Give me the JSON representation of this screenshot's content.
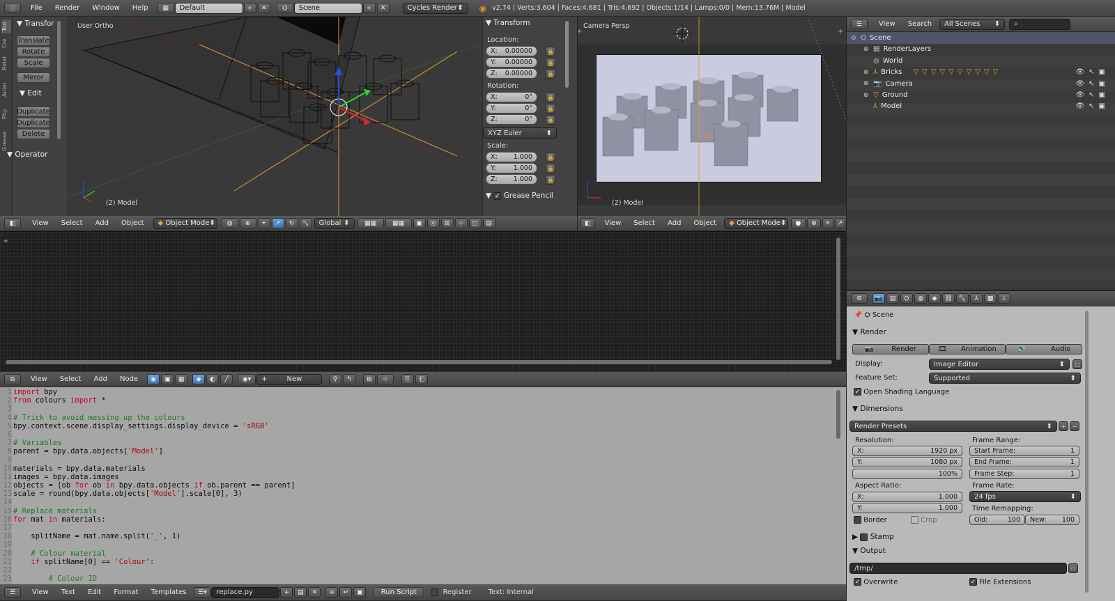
{
  "topbar": {
    "menus": [
      "File",
      "Render",
      "Window",
      "Help"
    ],
    "screen_layout": "Default",
    "scene": "Scene",
    "render_engine": "Cycles Render",
    "stats": "v2.74 | Verts:3,604 | Faces:4,681 | Tris:4,692 | Objects:1/14 | Lamps:0/0 | Mem:13.76M | Model"
  },
  "toolshelf": {
    "tabs": [
      "Too",
      "Cre",
      "Relat",
      "Anim",
      "Phy",
      "Grease"
    ],
    "transform_title": "Transfor",
    "transform_buttons": [
      "Translate",
      "Rotate",
      "Scale"
    ],
    "mirror": "Mirror",
    "edit_title": "Edit",
    "edit_buttons": [
      "Duplicate",
      "Duplicate",
      "Delete"
    ],
    "operator_title": "Operator"
  },
  "viewport_left": {
    "view_name": "User Ortho",
    "object_label": "(2) Model",
    "header": {
      "menus": [
        "View",
        "Select",
        "Add",
        "Object"
      ],
      "mode": "Object Mode",
      "orientation": "Global"
    }
  },
  "transform_panel": {
    "title": "Transform",
    "location_label": "Location:",
    "location": [
      {
        "axis": "X:",
        "value": "0.00000"
      },
      {
        "axis": "Y:",
        "value": "0.00000"
      },
      {
        "axis": "Z:",
        "value": "0.00000"
      }
    ],
    "rotation_label": "Rotation:",
    "rotation": [
      {
        "axis": "X:",
        "value": "0°"
      },
      {
        "axis": "Y:",
        "value": "0°"
      },
      {
        "axis": "Z:",
        "value": "0°"
      }
    ],
    "rotation_mode": "XYZ Euler",
    "scale_label": "Scale:",
    "scale": [
      {
        "axis": "X:",
        "value": "1.000"
      },
      {
        "axis": "Y:",
        "value": "1.000"
      },
      {
        "axis": "Z:",
        "value": "1.000"
      }
    ],
    "grease_pencil": "Grease Pencil"
  },
  "viewport_right": {
    "view_name": "Camera Persp",
    "object_label": "(2) Model",
    "header": {
      "menus": [
        "View",
        "Select",
        "Add",
        "Object"
      ],
      "mode": "Object Mode"
    }
  },
  "node_editor": {
    "header": {
      "menus": [
        "View",
        "Select",
        "Add",
        "Node"
      ],
      "new_button": "New"
    }
  },
  "text_editor": {
    "lines": [
      {
        "n": "1",
        "html": "<span class=\"kw\">import</span> bpy"
      },
      {
        "n": "2",
        "html": "<span class=\"kw\">from</span> colours <span class=\"kw\">import</span> *"
      },
      {
        "n": "3",
        "html": ""
      },
      {
        "n": "4",
        "html": "<span class=\"cm\"># Trick to avoid messing up the colours</span>"
      },
      {
        "n": "5",
        "html": "bpy.context.scene.display_settings.display_device = <span class=\"st\">'sRGB'</span>"
      },
      {
        "n": "6",
        "html": ""
      },
      {
        "n": "7",
        "html": "<span class=\"cm\"># Variables</span>"
      },
      {
        "n": "8",
        "html": "parent = bpy.data.objects[<span class=\"st\">'Model'</span>]"
      },
      {
        "n": "9",
        "html": ""
      },
      {
        "n": "10",
        "html": "materials = bpy.data.materials"
      },
      {
        "n": "11",
        "html": "images = bpy.data.images"
      },
      {
        "n": "12",
        "html": "objects = [ob <span class=\"kw\">for</span> ob <span class=\"kw\">in</span> bpy.data.objects <span class=\"kw\">if</span> ob.parent == parent]"
      },
      {
        "n": "13",
        "html": "scale = round(bpy.data.objects[<span class=\"st\">'Model'</span>].scale[0], 3)"
      },
      {
        "n": "14",
        "html": ""
      },
      {
        "n": "15",
        "html": "<span class=\"cm\"># Replace materials</span>"
      },
      {
        "n": "16",
        "html": "<span class=\"kw\">for</span> mat <span class=\"kw\">in</span> materials:"
      },
      {
        "n": "17",
        "html": ""
      },
      {
        "n": "18",
        "html": "    splitName = mat.name.split(<span class=\"st\">'_'</span>, 1)"
      },
      {
        "n": "19",
        "html": ""
      },
      {
        "n": "20",
        "html": "    <span class=\"cm\"># Colour material</span>"
      },
      {
        "n": "21",
        "html": "    <span class=\"kw\">if</span> splitName[0] == <span class=\"st\">'Colour'</span>:"
      },
      {
        "n": "22",
        "html": ""
      },
      {
        "n": "23",
        "html": "        <span class=\"cm\"># Colour ID</span>"
      }
    ],
    "footer": {
      "menus": [
        "View",
        "Text",
        "Edit",
        "Format",
        "Templates"
      ],
      "filename": "replace.py",
      "run_script": "Run Script",
      "register": "Register",
      "text_status": "Text: Internal"
    }
  },
  "outliner": {
    "header": {
      "menus": [
        "View",
        "Search"
      ],
      "filter": "All Scenes"
    },
    "items": [
      {
        "label": "Scene",
        "indent": 0,
        "icon": "scene-icon",
        "extra": ""
      },
      {
        "label": "RenderLayers",
        "indent": 1,
        "icon": "renderlayers-icon",
        "extra": ""
      },
      {
        "label": "World",
        "indent": 1,
        "icon": "world-icon",
        "extra": ""
      },
      {
        "label": "Bricks",
        "indent": 1,
        "icon": "armature-icon",
        "extra": "▽▽▽▽▽▽▽▽▽▽"
      },
      {
        "label": "Camera",
        "indent": 1,
        "icon": "camera-icon",
        "extra": ""
      },
      {
        "label": "Ground",
        "indent": 1,
        "icon": "mesh-icon",
        "extra": ""
      },
      {
        "label": "Model",
        "indent": 1,
        "icon": "empty-icon",
        "extra": ""
      }
    ]
  },
  "properties": {
    "context": "Scene",
    "render": {
      "title": "Render",
      "buttons": [
        "Render",
        "Animation",
        "Audio"
      ],
      "display_label": "Display:",
      "display_value": "Image Editor",
      "feature_label": "Feature Set:",
      "feature_value": "Supported",
      "osl": "Open Shading Language"
    },
    "dimensions": {
      "title": "Dimensions",
      "presets": "Render Presets",
      "resolution_label": "Resolution:",
      "res_x": {
        "axis": "X:",
        "value": "1920 px"
      },
      "res_y": {
        "axis": "Y:",
        "value": "1080 px"
      },
      "res_pct": "100%",
      "frame_range_label": "Frame Range:",
      "start": {
        "label": "Start Frame:",
        "value": "1"
      },
      "end": {
        "label": "End Frame:",
        "value": "1"
      },
      "step": {
        "label": "Frame Step:",
        "value": "1"
      },
      "aspect_label": "Aspect Ratio:",
      "asp_x": {
        "axis": "X:",
        "value": "1.000"
      },
      "asp_y": {
        "axis": "Y:",
        "value": "1.000"
      },
      "frame_rate_label": "Frame Rate:",
      "frame_rate": "24 fps",
      "time_remap_label": "Time Remapping:",
      "old": {
        "label": "Old:",
        "value": "100"
      },
      "new": {
        "label": "New:",
        "value": "100"
      },
      "border": "Border",
      "crop": "Crop"
    },
    "stamp": "Stamp",
    "output": {
      "title": "Output",
      "path": "/tmp/",
      "overwrite": "Overwrite",
      "file_ext": "File Extensions"
    }
  }
}
